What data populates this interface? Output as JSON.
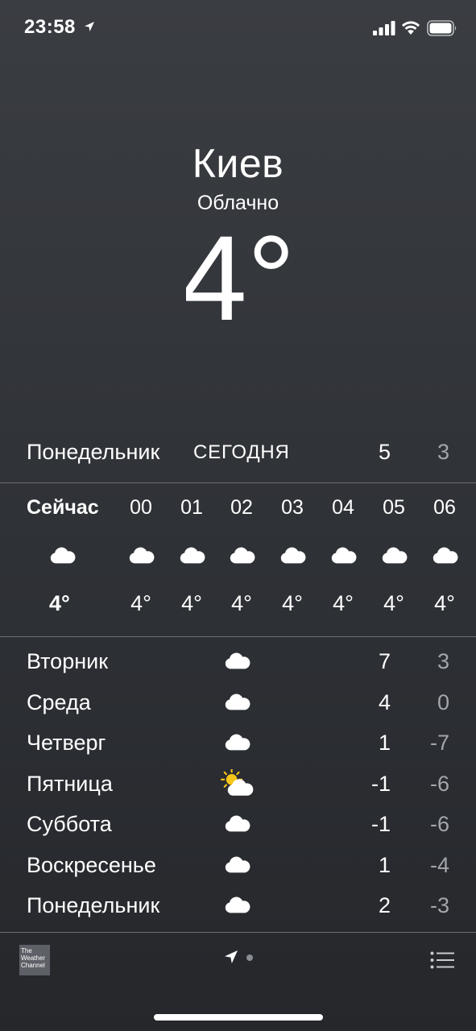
{
  "status_bar": {
    "time": "23:58",
    "icons": [
      "location-arrow-icon",
      "signal-icon",
      "wifi-icon",
      "battery-icon"
    ]
  },
  "header": {
    "city": "Киев",
    "condition": "Облачно",
    "temperature": "4°"
  },
  "today": {
    "day": "Понедельник",
    "label": "СЕГОДНЯ",
    "high": "5",
    "low": "3"
  },
  "hourly": [
    {
      "time": "Сейчас",
      "icon": "cloud-icon",
      "temp": "4°"
    },
    {
      "time": "00",
      "icon": "cloud-icon",
      "temp": "4°"
    },
    {
      "time": "01",
      "icon": "cloud-icon",
      "temp": "4°"
    },
    {
      "time": "02",
      "icon": "cloud-icon",
      "temp": "4°"
    },
    {
      "time": "03",
      "icon": "cloud-icon",
      "temp": "4°"
    },
    {
      "time": "04",
      "icon": "cloud-icon",
      "temp": "4°"
    },
    {
      "time": "05",
      "icon": "cloud-icon",
      "temp": "4°"
    },
    {
      "time": "06",
      "icon": "cloud-icon",
      "temp": "4°"
    }
  ],
  "daily": [
    {
      "day": "Вторник",
      "icon": "cloud-icon",
      "high": "7",
      "low": "3"
    },
    {
      "day": "Среда",
      "icon": "cloud-icon",
      "high": "4",
      "low": "0"
    },
    {
      "day": "Четверг",
      "icon": "cloud-icon",
      "high": "1",
      "low": "-7"
    },
    {
      "day": "Пятница",
      "icon": "partly-sunny-icon",
      "high": "-1",
      "low": "-6"
    },
    {
      "day": "Суббота",
      "icon": "cloud-icon",
      "high": "-1",
      "low": "-6"
    },
    {
      "day": "Воскресенье",
      "icon": "cloud-icon",
      "high": "1",
      "low": "-4"
    },
    {
      "day": "Понедельник",
      "icon": "cloud-icon",
      "high": "2",
      "low": "-3"
    }
  ],
  "toolbar": {
    "logo_lines": [
      "The",
      "Weather",
      "Channel"
    ],
    "icons": [
      "weather-channel-logo",
      "location-arrow-icon",
      "page-dot",
      "list-icon"
    ]
  },
  "colors": {
    "background_top": "#3a3d42",
    "background_bottom": "#25272b",
    "text": "#ffffff",
    "secondary_text": "#a3a6ab",
    "divider": "#6b6e73"
  }
}
